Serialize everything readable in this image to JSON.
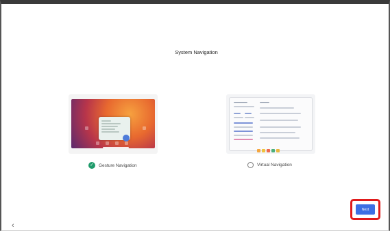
{
  "page": {
    "title": "System Navigation",
    "back_icon": "chevron-left-icon"
  },
  "options": [
    {
      "label": "Gesture Navigation",
      "selected": true,
      "preview_icon": "gesture-preview"
    },
    {
      "label": "Virtual Navigation",
      "selected": false,
      "preview_icon": "virtual-preview"
    }
  ],
  "footer": {
    "next_label": "Next",
    "highlight_color": "#e01b1b",
    "accent_color": "#3d6fe3"
  }
}
